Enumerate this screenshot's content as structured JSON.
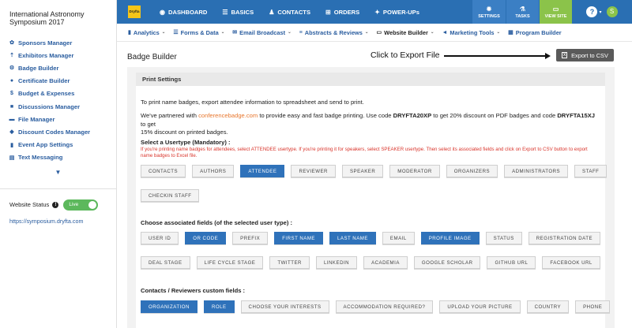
{
  "event": {
    "title": "International Astronomy Symposium 2017"
  },
  "sidebar": {
    "items": [
      {
        "label": "Sponsors Manager",
        "icon": "handshake-icon",
        "glyph": "✿"
      },
      {
        "label": "Exhibitors Manager",
        "icon": "exhibitor-icon",
        "glyph": "⇡"
      },
      {
        "label": "Badge Builder",
        "icon": "badge-icon",
        "glyph": "⚙"
      },
      {
        "label": "Certificate Builder",
        "icon": "certificate-icon",
        "glyph": "●"
      },
      {
        "label": "Budget & Expenses",
        "icon": "dollar-icon",
        "glyph": "$"
      },
      {
        "label": "Discussions Manager",
        "icon": "chat-icon",
        "glyph": "■"
      },
      {
        "label": "File Manager",
        "icon": "folder-icon",
        "glyph": "▬"
      },
      {
        "label": "Discount Codes Manager",
        "icon": "tag-icon",
        "glyph": "◆"
      },
      {
        "label": "Event App Settings",
        "icon": "mobile-icon",
        "glyph": "▮"
      },
      {
        "label": "Text Messaging",
        "icon": "message-icon",
        "glyph": "▤"
      }
    ],
    "more_glyph": "▼",
    "website_status_label": "Website Status",
    "info_glyph": "!",
    "toggle_label": "Live",
    "site_url": "https://symposium.dryfta.com"
  },
  "topbar": {
    "logo_text": "Dryfta",
    "nav": [
      {
        "label": "DASHBOARD",
        "icon": "dashboard-icon",
        "glyph": "◉"
      },
      {
        "label": "BASICS",
        "icon": "list-icon",
        "glyph": "☰"
      },
      {
        "label": "CONTACTS",
        "icon": "contacts-icon",
        "glyph": "♟"
      },
      {
        "label": "ORDERS",
        "icon": "cart-icon",
        "glyph": "⊞"
      },
      {
        "label": "POWER-UPs",
        "icon": "powerups-icon",
        "glyph": "✦"
      }
    ],
    "settings_label": "SETTINGS",
    "tasks_label": "TASKS",
    "view_site_label": "VIEW SITE",
    "settings_glyph": "✹",
    "tasks_glyph": "⚗",
    "view_glyph": "▭",
    "help_glyph": "?",
    "caret_glyph": "▾",
    "avatar_initial": "S"
  },
  "subnav": [
    {
      "label": "Analytics",
      "icon": "bar-chart-icon",
      "glyph": "▮",
      "caret": true,
      "active": false
    },
    {
      "label": "Forms & Data",
      "icon": "forms-icon",
      "glyph": "☰",
      "caret": true,
      "active": false
    },
    {
      "label": "Email Broadcast",
      "icon": "email-icon",
      "glyph": "✉",
      "caret": true,
      "active": false
    },
    {
      "label": "Abstracts & Reviews",
      "icon": "abstracts-icon",
      "glyph": "≡",
      "caret": true,
      "active": false
    },
    {
      "label": "Website Builder",
      "icon": "laptop-icon",
      "glyph": "▭",
      "caret": true,
      "active": true
    },
    {
      "label": "Marketing Tools",
      "icon": "bullhorn-icon",
      "glyph": "◄",
      "caret": true,
      "active": false
    },
    {
      "label": "Program Builder",
      "icon": "calendar-icon",
      "glyph": "▦",
      "caret": false,
      "active": false
    }
  ],
  "page": {
    "title": "Badge Builder",
    "annotation": "Click to Export File",
    "export_label": "Export to CSV",
    "export_glyph": "x"
  },
  "print_settings": {
    "heading": "Print Settings",
    "intro": "To print name badges, export attendee information to spreadsheet and send to print.",
    "partner_1": "We've partnered with ",
    "partner_link": "conferencebadge.com",
    "partner_2": " to provide easy and fast badge printing. Use code ",
    "code_1": "DRYFTA20XP",
    "partner_3": " to get 20% discount on PDF badges and code ",
    "code_2": "DRYFTA15XJ",
    "partner_4": " to get",
    "partner_line2": "15% discount on printed badges.",
    "usertype_title": "Select a Usertype (Mandatory) :",
    "usertype_note_1": "If you're printing name badges for attendees, select ATTENDEE usertype. If you're printing it for speakers, select SPEAKER usertype. Then select its associated fields and click on Export to CSV button to export",
    "usertype_note_2": "name badges to Excel file.",
    "usertypes_row1": [
      {
        "label": "CONTACTS",
        "selected": false
      },
      {
        "label": "AUTHORS",
        "selected": false
      },
      {
        "label": "ATTENDEE",
        "selected": true
      },
      {
        "label": "REVIEWER",
        "selected": false
      },
      {
        "label": "SPEAKER",
        "selected": false
      },
      {
        "label": "MODERATOR",
        "selected": false
      },
      {
        "label": "ORGANIZERS",
        "selected": false
      },
      {
        "label": "ADMINISTRATORS",
        "selected": false
      },
      {
        "label": "STAFF",
        "selected": false
      }
    ],
    "usertypes_row2": [
      {
        "label": "CHECKIN STAFF",
        "selected": false
      }
    ],
    "fields_title": "Choose associated fields (of the selected user type) :",
    "fields_row1": [
      {
        "label": "USER ID",
        "selected": false
      },
      {
        "label": "OR CODE",
        "selected": true
      },
      {
        "label": "PREFIX",
        "selected": false
      },
      {
        "label": "FIRST NAME",
        "selected": true
      },
      {
        "label": "LAST NAME",
        "selected": true
      },
      {
        "label": "EMAIL",
        "selected": false
      },
      {
        "label": "PROFILE IMAGE",
        "selected": true
      },
      {
        "label": "STATUS",
        "selected": false
      },
      {
        "label": "REGISTRATION DATE",
        "selected": false
      }
    ],
    "fields_row2": [
      {
        "label": "DEAL STAGE",
        "selected": false
      },
      {
        "label": "LIFE CYCLE STAGE",
        "selected": false
      },
      {
        "label": "TWITTER",
        "selected": false
      },
      {
        "label": "LINKEDIN",
        "selected": false
      },
      {
        "label": "ACADEMIA",
        "selected": false
      },
      {
        "label": "GOOGLE SCHOLAR",
        "selected": false
      },
      {
        "label": "GITHUB URL",
        "selected": false
      },
      {
        "label": "FACEBOOK URL",
        "selected": false
      }
    ],
    "custom_title": "Contacts / Reviewers custom fields :",
    "custom_row1": [
      {
        "label": "ORGANIZATION",
        "selected": true
      },
      {
        "label": "ROLE",
        "selected": true
      },
      {
        "label": "CHOOSE YOUR INTERESTS",
        "selected": false
      },
      {
        "label": "ACCOMMODATION REQUIRED?",
        "selected": false
      },
      {
        "label": "UPLOAD YOUR PICTURE",
        "selected": false
      },
      {
        "label": "COUNTRY",
        "selected": false
      },
      {
        "label": "PHONE",
        "selected": false
      }
    ]
  }
}
